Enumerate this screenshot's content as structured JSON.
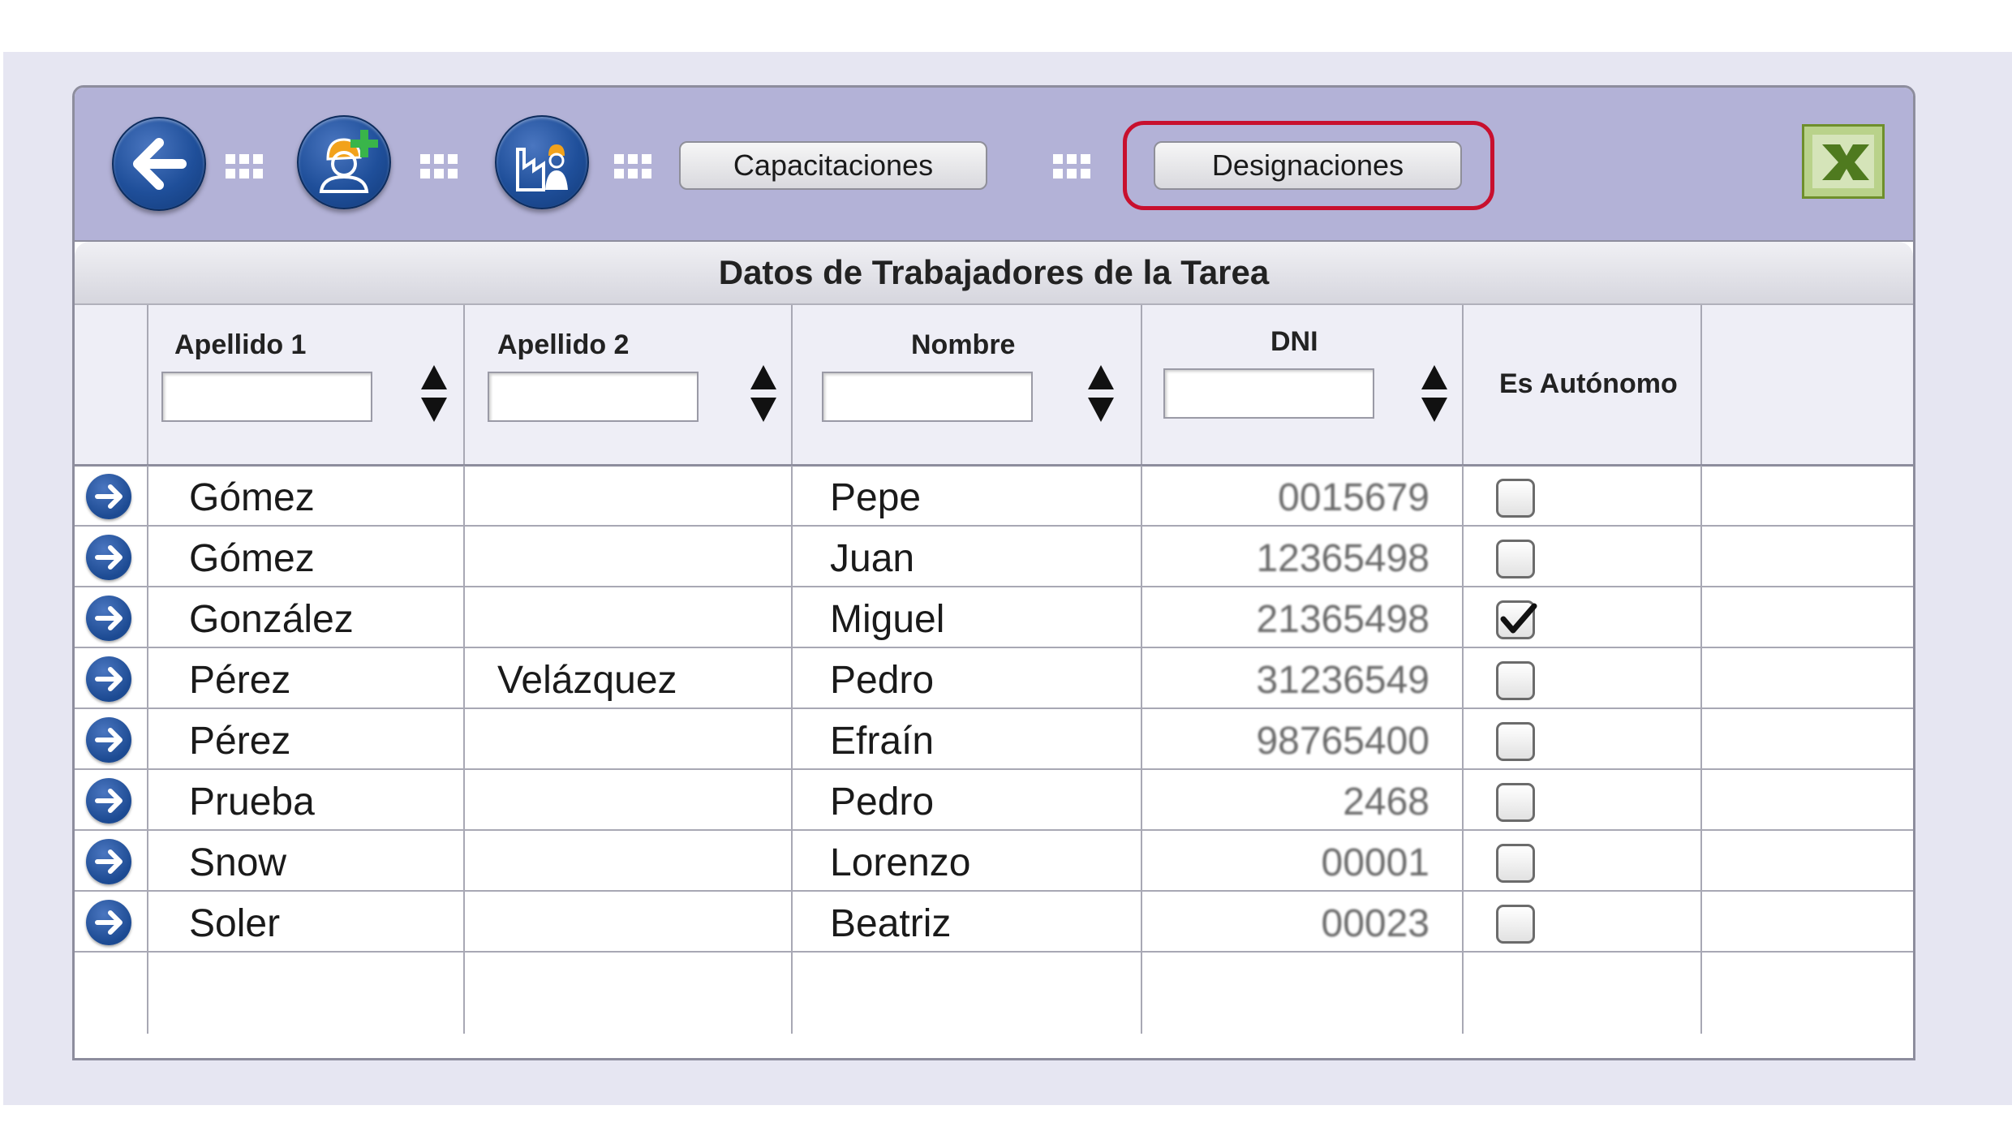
{
  "toolbar": {
    "back_button": "back-arrow-icon",
    "add_worker_button": "add-worker-icon",
    "company_button": "factory-worker-icon",
    "capacitaciones_label": "Capacitaciones",
    "designaciones_label": "Designaciones",
    "export_button": "excel-icon",
    "highlight_color": "#c8102e"
  },
  "section_title": "Datos de Trabajadores de la Tarea",
  "columns": {
    "apellido1": "Apellido 1",
    "apellido2": "Apellido 2",
    "nombre": "Nombre",
    "dni": "DNI",
    "autonomo": "Es Autónomo"
  },
  "filters": {
    "apellido1": "",
    "apellido2": "",
    "nombre": "",
    "dni": ""
  },
  "rows": [
    {
      "apellido1": "Gómez",
      "apellido2": "",
      "nombre": "Pepe",
      "dni": "0015679",
      "autonomo": false
    },
    {
      "apellido1": "Gómez",
      "apellido2": "",
      "nombre": "Juan",
      "dni": "12365498",
      "autonomo": false
    },
    {
      "apellido1": "González",
      "apellido2": "",
      "nombre": "Miguel",
      "dni": "21365498",
      "autonomo": true
    },
    {
      "apellido1": "Pérez",
      "apellido2": "Velázquez",
      "nombre": "Pedro",
      "dni": "31236549",
      "autonomo": false
    },
    {
      "apellido1": "Pérez",
      "apellido2": "",
      "nombre": "Efraín",
      "dni": "98765400",
      "autonomo": false
    },
    {
      "apellido1": "Prueba",
      "apellido2": "",
      "nombre": "Pedro",
      "dni": "2468",
      "autonomo": false
    },
    {
      "apellido1": "Snow",
      "apellido2": "",
      "nombre": "Lorenzo",
      "dni": "00001",
      "autonomo": false
    },
    {
      "apellido1": "Soler",
      "apellido2": "",
      "nombre": "Beatriz",
      "dni": "00023",
      "autonomo": false
    }
  ]
}
